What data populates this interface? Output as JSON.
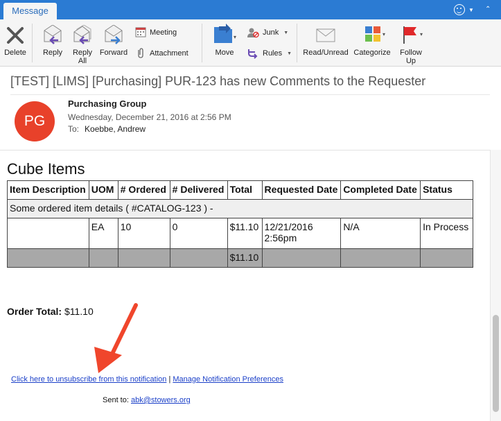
{
  "tabs": {
    "message": "Message"
  },
  "ribbon": {
    "delete": "Delete",
    "reply": "Reply",
    "reply_all_1": "Reply",
    "reply_all_2": "All",
    "forward": "Forward",
    "meeting": "Meeting",
    "attachment": "Attachment",
    "move": "Move",
    "junk": "Junk",
    "rules": "Rules",
    "read_unread": "Read/Unread",
    "categorize": "Categorize",
    "follow_up_1": "Follow",
    "follow_up_2": "Up"
  },
  "email": {
    "subject": "[TEST] [LIMS] [Purchasing] PUR-123 has new Comments to the Requester",
    "avatar_initials": "PG",
    "sender": "Purchasing Group",
    "date": "Wednesday, December 21, 2016 at 2:56 PM",
    "to_label": "To:",
    "to_name": "Koebbe, Andrew"
  },
  "body": {
    "section_title": "Cube Items",
    "table": {
      "headers": [
        "Item Description",
        "UOM",
        "# Ordered",
        "# Delivered",
        "Total",
        "Requested Date",
        "Completed Date",
        "Status"
      ],
      "detail": "Some ordered item details ( #CATALOG-123 ) -",
      "row": [
        "",
        "EA",
        "10",
        "0",
        "$11.10",
        "12/21/2016 2:56pm",
        "N/A",
        "In Process"
      ],
      "total_row": [
        "",
        "",
        "",
        "",
        "$11.10",
        "",
        "",
        ""
      ]
    },
    "order_total_label": "Order Total:",
    "order_total_value": "$11.10",
    "unsubscribe": "Click here to unsubscribe from this notification",
    "link_separator": "|",
    "manage_prefs": "Manage Notification Preferences",
    "sent_to_label": "Sent to:",
    "sent_to_email": "abk@stowers.org"
  },
  "colors": {
    "tabbar": "#2b7bd3",
    "avatar": "#e8412a",
    "link": "#1a3fc8",
    "arrow": "#f0462c"
  }
}
